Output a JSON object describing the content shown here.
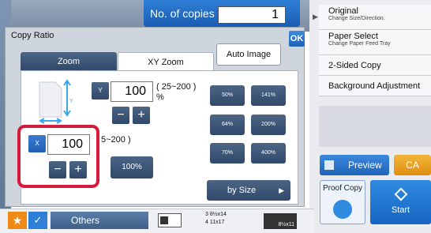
{
  "copies": {
    "label": "No. of copies",
    "value": "1"
  },
  "right_panel": {
    "items": [
      {
        "title": "Original",
        "sub": "Change Size/Direction."
      },
      {
        "title": "Paper Select",
        "sub": "Change Paper Feed Tray"
      },
      {
        "title": "2-Sided Copy",
        "sub": ""
      },
      {
        "title": "Background Adjustment",
        "sub": ""
      }
    ],
    "preview_label": "Preview",
    "ca_label": "CA",
    "proof_copy_label": "Proof Copy",
    "start_label": "Start"
  },
  "bottom": {
    "others_label": "Others",
    "tray_line1": "3   8½x14",
    "tray_line2": "4    11x17",
    "tray_paper": "8½x11"
  },
  "dialog": {
    "title": "Copy Ratio",
    "ok_label": "OK",
    "tabs": {
      "zoom": "Zoom",
      "xy_zoom": "XY Zoom"
    },
    "auto_image_label": "Auto Image",
    "y": {
      "label": "Y",
      "value": "100",
      "range": "( 25~200 )",
      "unit": "%"
    },
    "x": {
      "label": "X",
      "value": "100",
      "range": "5~200 )"
    },
    "stepper": {
      "minus": "−",
      "plus": "+"
    },
    "presets": [
      "50%",
      "141%",
      "64%",
      "200%",
      "70%",
      "400%"
    ],
    "reset_label": "100%",
    "by_size_label": "by Size"
  },
  "colors": {
    "accent": "#1f64b9",
    "highlight": "#d61a3c",
    "orange": "#ef8a16"
  }
}
